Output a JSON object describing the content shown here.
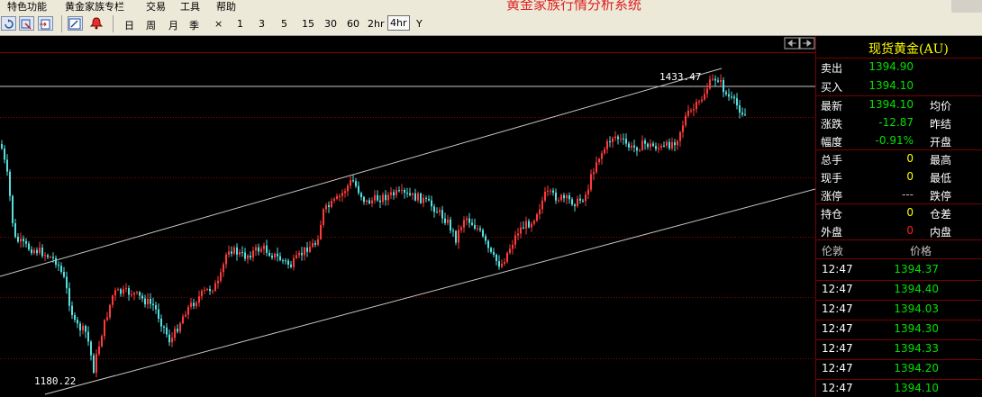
{
  "menu": {
    "items": [
      "特色功能",
      "黄金家族专栏",
      "交易",
      "工具",
      "帮助"
    ],
    "app_title": "黄金家族行情分析系统"
  },
  "toolbar": {
    "periods": [
      "日",
      "周",
      "月",
      "季",
      "×",
      "1",
      "3",
      "5",
      "15",
      "30",
      "60",
      "2hr",
      "4hr",
      "Y"
    ],
    "active_period": "4hr",
    "icons": [
      "refresh-icon",
      "zoom-icon",
      "export-icon",
      "draw-pen-icon",
      "alarm-bell-icon"
    ]
  },
  "chart": {
    "label_high": "1433.47",
    "label_low": "1180.22"
  },
  "quote": {
    "title": "现货黄金(AU)",
    "sell_label": "卖出",
    "sell_value": "1394.90",
    "buy_label": "买入",
    "buy_value": "1394.10",
    "latest_label": "最新",
    "latest_value": "1394.10",
    "avg_label": "均价",
    "change_label": "涨跌",
    "change_value": "-12.87",
    "prevclose_label": "昨结",
    "pct_label": "幅度",
    "pct_value": "-0.91%",
    "open_label": "开盘",
    "total_label": "总手",
    "total_value": "0",
    "high_label": "最高",
    "cur_label": "现手",
    "cur_value": "0",
    "low_label": "最低",
    "limitup_label": "涨停",
    "limitup_value": "---",
    "limitdown_label": "跌停",
    "hold_label": "持仓",
    "hold_value": "0",
    "posdiff_label": "仓差",
    "outer_label": "外盘",
    "outer_value": "0",
    "inner_label": "内盘"
  },
  "ticks": {
    "col_time": "伦敦",
    "col_price": "价格",
    "rows": [
      {
        "time": "12:47",
        "price": "1394.37"
      },
      {
        "time": "12:47",
        "price": "1394.40"
      },
      {
        "time": "12:47",
        "price": "1394.03"
      },
      {
        "time": "12:47",
        "price": "1394.30"
      },
      {
        "time": "12:47",
        "price": "1394.33"
      },
      {
        "time": "12:47",
        "price": "1394.20"
      },
      {
        "time": "12:47",
        "price": "1394.10"
      }
    ]
  },
  "colors": {
    "up": "#ff3a3a",
    "down": "#55e0e0",
    "green": "#00e000",
    "red": "#ff2020",
    "yellow": "#ffff00"
  }
}
